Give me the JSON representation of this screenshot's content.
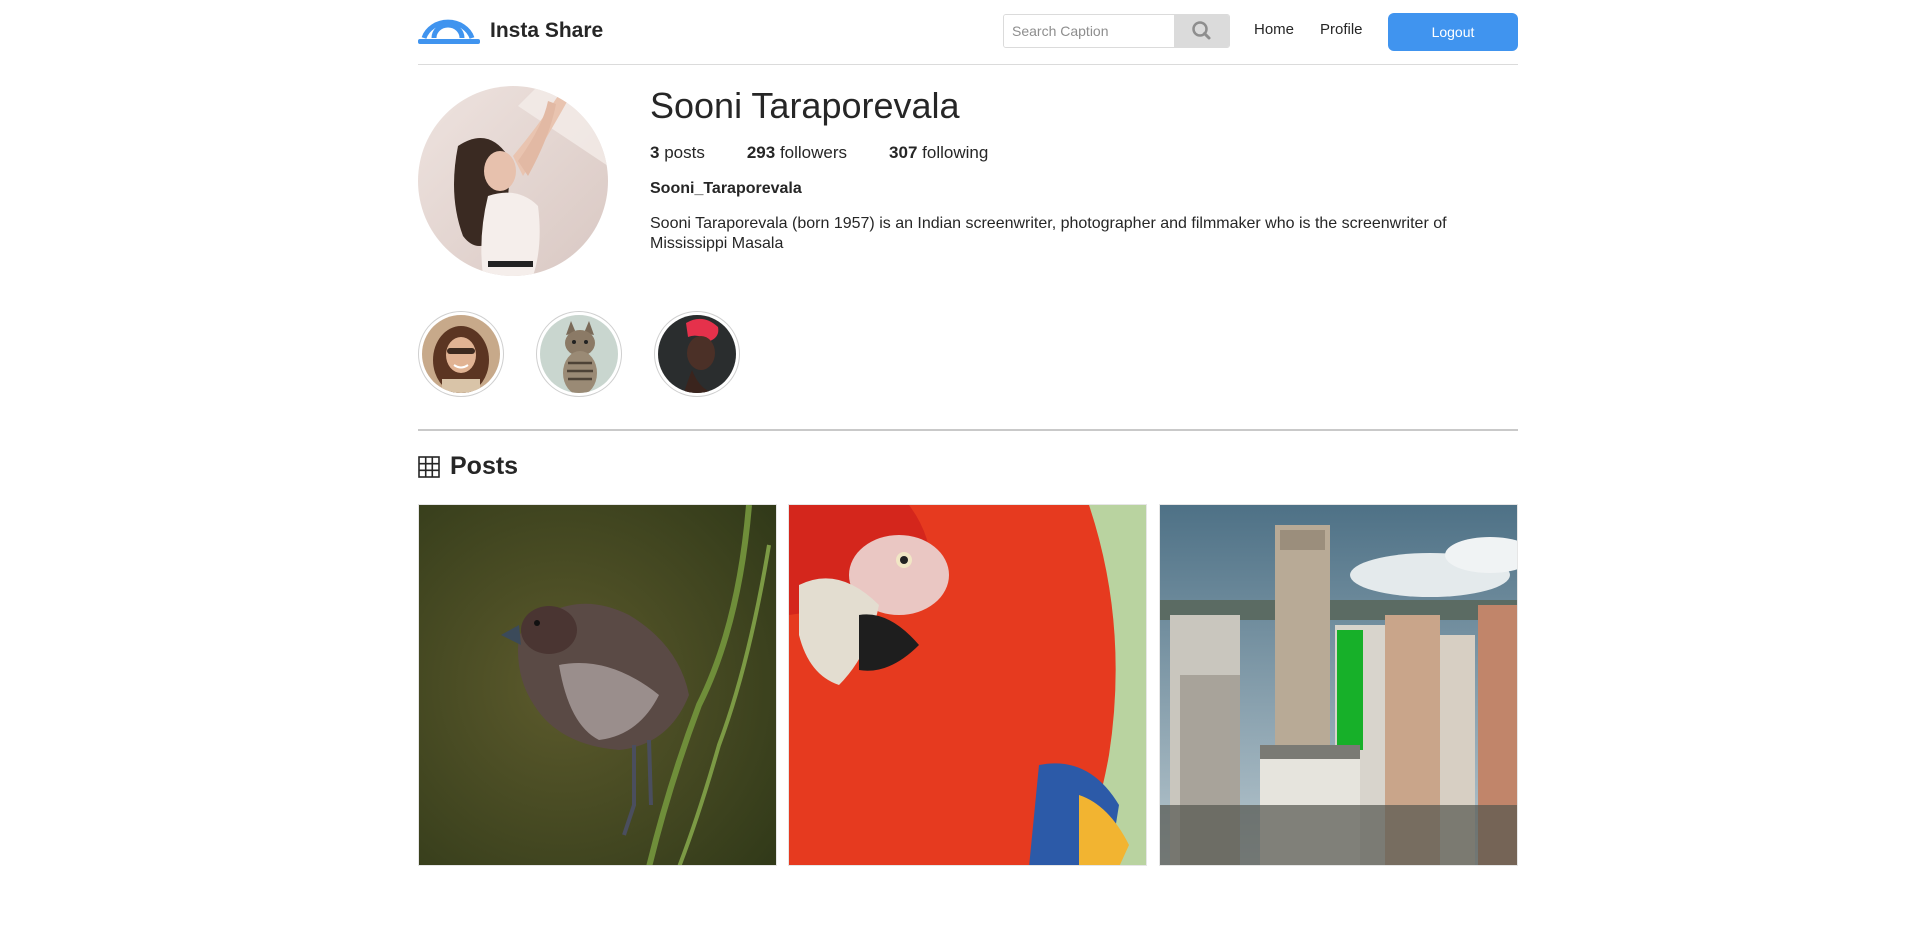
{
  "header": {
    "brand": "Insta Share",
    "search_placeholder": "Search Caption",
    "nav_home": "Home",
    "nav_profile": "Profile",
    "logout_label": "Logout",
    "accent_color": "#4094ef"
  },
  "profile": {
    "name": "Sooni Taraporevala",
    "posts_count": "3",
    "posts_label": "posts",
    "followers_count": "293",
    "followers_label": "followers",
    "following_count": "307",
    "following_label": "following",
    "username": "Sooni_Taraporevala",
    "bio": "Sooni Taraporevala (born 1957) is an Indian screenwriter, photographer and filmmaker who is the screenwriter of Mississippi Masala"
  },
  "stories": [
    {
      "subject": "woman with sunglasses"
    },
    {
      "subject": "tabby cat"
    },
    {
      "subject": "woman with red hair"
    }
  ],
  "posts_section": {
    "title": "Posts",
    "icon": "grid-icon"
  },
  "posts": [
    {
      "subject": "bird on branch"
    },
    {
      "subject": "red macaw parrot"
    },
    {
      "subject": "city buildings"
    }
  ]
}
